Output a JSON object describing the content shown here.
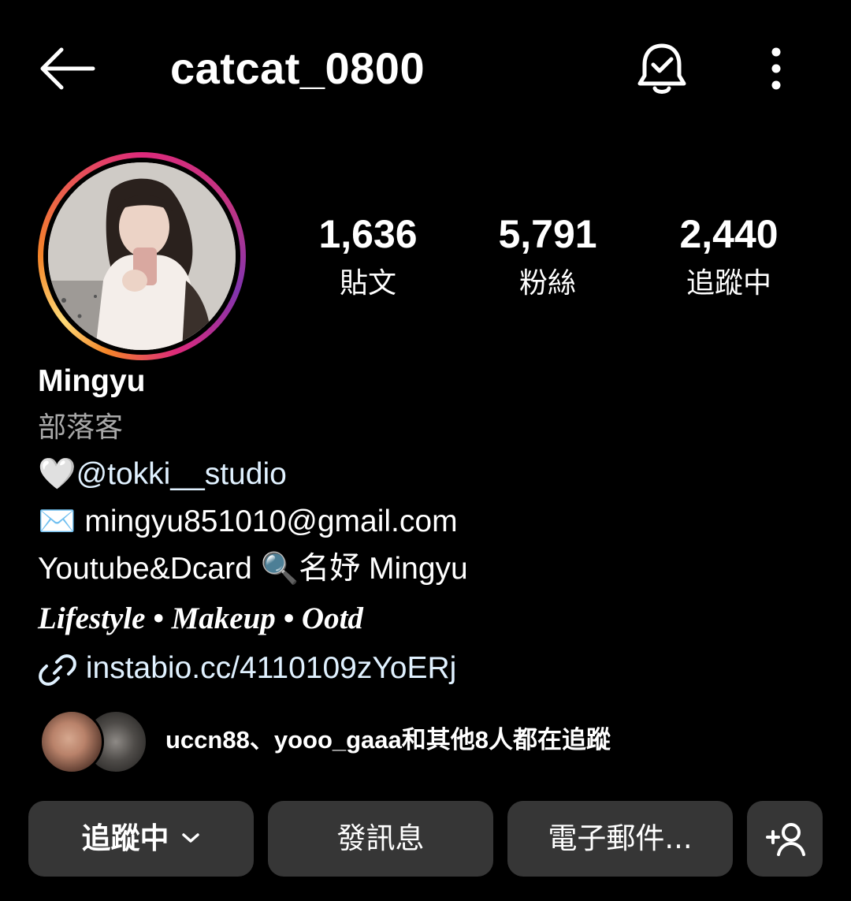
{
  "header": {
    "username": "catcat_0800",
    "back_icon": "arrow-left-icon",
    "notifications_icon": "bell-check-icon",
    "more_icon": "more-vertical-icon"
  },
  "stats": {
    "posts": {
      "count": "1,636",
      "label": "貼文"
    },
    "followers": {
      "count": "5,791",
      "label": "粉絲"
    },
    "following": {
      "count": "2,440",
      "label": "追蹤中"
    }
  },
  "bio": {
    "name": "Mingyu",
    "category": "部落客",
    "mention_prefix": "🤍",
    "mention": "@tokki__studio",
    "email_prefix": "✉️",
    "email": " mingyu851010@gmail.com",
    "youtube_line_start": "Youtube&Dcard ",
    "youtube_line_emoji": "🔍",
    "youtube_line_end": "名妤 Mingyu",
    "tagline": "Lifestyle • Makeup • Ootd",
    "link": "instabio.cc/4110109zYoERj"
  },
  "mutual_followers": {
    "text": "uccn88、yooo_gaaa和其他8人都在追蹤"
  },
  "actions": {
    "following_label": "追蹤中",
    "message_label": "發訊息",
    "email_label": "電子郵件...",
    "add_user_icon": "add-user-icon"
  },
  "colors": {
    "background": "#000000",
    "button": "#363636",
    "link": "#e0f1ff",
    "secondary_text": "#a8a8a8"
  }
}
